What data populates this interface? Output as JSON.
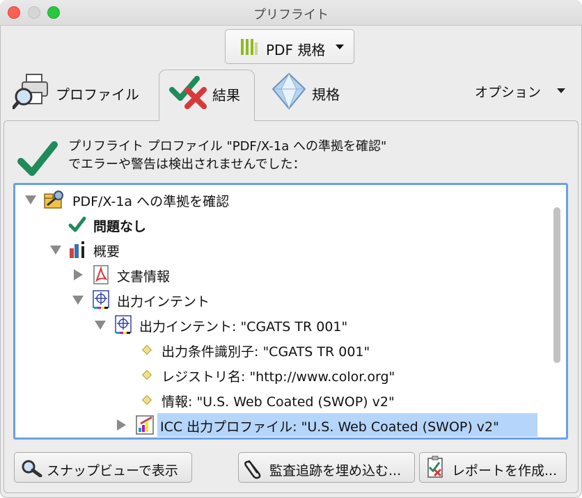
{
  "window": {
    "title": "プリフライト"
  },
  "standard_dropdown": {
    "label": "PDF 規格"
  },
  "tabs": [
    {
      "label": "プロファイル",
      "icon": "printer-magnifier-icon",
      "active": false
    },
    {
      "label": "結果",
      "icon": "check-cross-icon",
      "active": true
    },
    {
      "label": "規格",
      "icon": "diamond-icon",
      "active": false
    }
  ],
  "options": {
    "label": "オプション"
  },
  "summary": {
    "line1": "プリフライト プロファイル \"PDF/X-1a への準拠を確認\"",
    "line2": "でエラーや警告は検出されませんでした："
  },
  "tree": {
    "root": "PDF/X-1a への準拠を確認",
    "no_problems": "問題なし",
    "overview": "概要",
    "document_info": "文書情報",
    "output_intents": "出力インテント",
    "output_intent": "出力インテント: \"CGATS TR 001\"",
    "condition_id": "出力条件識別子: \"CGATS TR 001\"",
    "registry": "レジストリ名: \"http://www.color.org\"",
    "info": "情報: \"U.S. Web Coated (SWOP) v2\"",
    "icc_profile": "ICC 出力プロファイル: \"U.S. Web Coated (SWOP) v2\""
  },
  "buttons": {
    "snap": "スナップビューで表示",
    "audit": "監査追跡を埋め込む...",
    "report": "レポートを作成..."
  },
  "colors": {
    "accent": "#6aa1e6",
    "check": "#1f8a5a",
    "cross": "#d63a3a",
    "selection": "#b5d5fb"
  }
}
